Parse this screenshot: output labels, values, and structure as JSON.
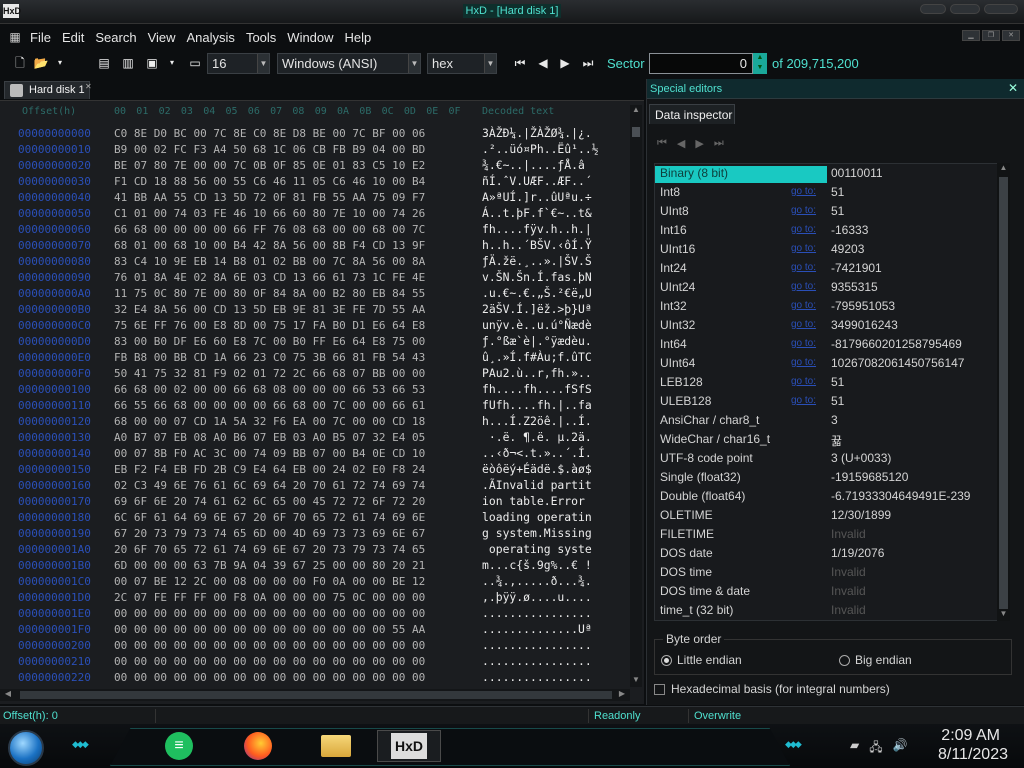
{
  "window": {
    "title": "HxD - [Hard disk 1]",
    "app_icon": "HxD"
  },
  "menu": [
    "File",
    "Edit",
    "Search",
    "View",
    "Analysis",
    "Tools",
    "Window",
    "Help"
  ],
  "toolbar": {
    "bytes_per_row": "16",
    "charset": "Windows (ANSI)",
    "offset_base": "hex",
    "sector_label": "Sector",
    "sector_value": "0",
    "sector_total": "of 209,715,200"
  },
  "document_tab": "Hard disk 1",
  "hex_header": {
    "offset_label": "Offset(h)",
    "columns": [
      "00",
      "01",
      "02",
      "03",
      "04",
      "05",
      "06",
      "07",
      "08",
      "09",
      "0A",
      "0B",
      "0C",
      "0D",
      "0E",
      "0F"
    ],
    "text_label": "Decoded text"
  },
  "hex_rows": [
    {
      "offset": "00000000000",
      "bytes": "C0 8E D0 BC 00 7C 8E C0 8E D8 BE 00 7C BF 00 06",
      "text": "3ÀŽÐ¼.|ŽÀŽØ¾.|¿."
    },
    {
      "offset": "00000000010",
      "bytes": "B9 00 02 FC F3 A4 50 68 1C 06 CB FB B9 04 00 BD",
      "text": ".²..üó¤Ph..Ëû¹..½"
    },
    {
      "offset": "00000000020",
      "bytes": "BE 07 80 7E 00 00 7C 0B 0F 85 0E 01 83 C5 10 E2",
      "text": "¾.€~..|....ƒÅ.â"
    },
    {
      "offset": "00000000030",
      "bytes": "F1 CD 18 88 56 00 55 C6 46 11 05 C6 46 10 00 B4",
      "text": "ñÍ.ˆV.UÆF..ÆF..´"
    },
    {
      "offset": "00000000040",
      "bytes": "41 BB AA 55 CD 13 5D 72 0F 81 FB 55 AA 75 09 F7",
      "text": "A»ªUÍ.]r..ûUªu.÷"
    },
    {
      "offset": "00000000050",
      "bytes": "C1 01 00 74 03 FE 46 10 66 60 80 7E 10 00 74 26",
      "text": "Á..t.þF.f`€~..t&"
    },
    {
      "offset": "00000000060",
      "bytes": "66 68 00 00 00 00 66 FF 76 08 68 00 00 68 00 7C",
      "text": "fh....fÿv.h..h.|"
    },
    {
      "offset": "00000000070",
      "bytes": "68 01 00 68 10 00 B4 42 8A 56 00 8B F4 CD 13 9F",
      "text": "h..h..´BŠV.‹ôÍ.Ÿ"
    },
    {
      "offset": "00000000080",
      "bytes": "83 C4 10 9E EB 14 B8 01 02 BB 00 7C 8A 56 00 8A",
      "text": "ƒÄ.žë.¸..».|ŠV.Š"
    },
    {
      "offset": "00000000090",
      "bytes": "76 01 8A 4E 02 8A 6E 03 CD 13 66 61 73 1C FE 4E",
      "text": "v.ŠN.Šn.Í.fas.þN"
    },
    {
      "offset": "000000000A0",
      "bytes": "11 75 0C 80 7E 00 80 0F 84 8A 00 B2 80 EB 84 55",
      "text": ".u.€~.€.„Š.²€ë„U"
    },
    {
      "offset": "000000000B0",
      "bytes": "32 E4 8A 56 00 CD 13 5D EB 9E 81 3E FE 7D 55 AA",
      "text": "2äŠV.Í.]ëž.>þ}Uª"
    },
    {
      "offset": "000000000C0",
      "bytes": "75 6E FF 76 00 E8 8D 00 75 17 FA B0 D1 E6 64 E8",
      "text": "unÿv.è..u.ú°Ñædè"
    },
    {
      "offset": "000000000D0",
      "bytes": "83 00 B0 DF E6 60 E8 7C 00 B0 FF E6 64 E8 75 00",
      "text": "ƒ.°ßæ`è|.°ÿædèu."
    },
    {
      "offset": "000000000E0",
      "bytes": "FB B8 00 BB CD 1A 66 23 C0 75 3B 66 81 FB 54 43",
      "text": "û¸.»Í.f#Àu;f.ûTC"
    },
    {
      "offset": "000000000F0",
      "bytes": "50 41 75 32 81 F9 02 01 72 2C 66 68 07 BB 00 00",
      "text": "PAu2.ù..r,fh.».."
    },
    {
      "offset": "00000000100",
      "bytes": "66 68 00 02 00 00 66 68 08 00 00 00 66 53 66 53",
      "text": "fh....fh....fSfS"
    },
    {
      "offset": "00000000110",
      "bytes": "66 55 66 68 00 00 00 00 66 68 00 7C 00 00 66 61",
      "text": "fUfh....fh.|..fa"
    },
    {
      "offset": "00000000120",
      "bytes": "68 00 00 07 CD 1A 5A 32 F6 EA 00 7C 00 00 CD 18",
      "text": "h...Í.Z2öê.|..Í."
    },
    {
      "offset": "00000000130",
      "bytes": "A0 B7 07 EB 08 A0 B6 07 EB 03 A0 B5 07 32 E4 05",
      "text": " ·.ë. ¶.ë. µ.2ä."
    },
    {
      "offset": "00000000140",
      "bytes": "00 07 8B F0 AC 3C 00 74 09 BB 07 00 B4 0E CD 10",
      "text": "..‹ð¬<.t.»..´.Í."
    },
    {
      "offset": "00000000150",
      "bytes": "EB F2 F4 EB FD 2B C9 E4 64 EB 00 24 02 E0 F8 24",
      "text": "ëòôëý+Éädë.$.àø$"
    },
    {
      "offset": "00000000160",
      "bytes": "02 C3 49 6E 76 61 6C 69 64 20 70 61 72 74 69 74",
      "text": ".ÃInvalid partit"
    },
    {
      "offset": "00000000170",
      "bytes": "69 6F 6E 20 74 61 62 6C 65 00 45 72 72 6F 72 20",
      "text": "ion table.Error "
    },
    {
      "offset": "00000000180",
      "bytes": "6C 6F 61 64 69 6E 67 20 6F 70 65 72 61 74 69 6E",
      "text": "loading operatin"
    },
    {
      "offset": "00000000190",
      "bytes": "67 20 73 79 73 74 65 6D 00 4D 69 73 73 69 6E 67",
      "text": "g system.Missing"
    },
    {
      "offset": "000000001A0",
      "bytes": "20 6F 70 65 72 61 74 69 6E 67 20 73 79 73 74 65",
      "text": " operating syste"
    },
    {
      "offset": "000000001B0",
      "bytes": "6D 00 00 00 63 7B 9A 04 39 67 25 00 00 80 20 21",
      "text": "m...c{š.9g%..€ !"
    },
    {
      "offset": "000000001C0",
      "bytes": "00 07 BE 12 2C 00 08 00 00 00 F0 0A 00 00 BE 12",
      "text": "..¾.,.....ð...¾."
    },
    {
      "offset": "000000001D0",
      "bytes": "2C 07 FE FF FF 00 F8 0A 00 00 00 75 0C 00 00 00",
      "text": ",.þÿÿ.ø....u...."
    },
    {
      "offset": "000000001E0",
      "bytes": "00 00 00 00 00 00 00 00 00 00 00 00 00 00 00 00",
      "text": "................"
    },
    {
      "offset": "000000001F0",
      "bytes": "00 00 00 00 00 00 00 00 00 00 00 00 00 00 55 AA",
      "text": "..............Uª"
    },
    {
      "offset": "00000000200",
      "bytes": "00 00 00 00 00 00 00 00 00 00 00 00 00 00 00 00",
      "text": "................"
    },
    {
      "offset": "00000000210",
      "bytes": "00 00 00 00 00 00 00 00 00 00 00 00 00 00 00 00",
      "text": "................"
    },
    {
      "offset": "00000000220",
      "bytes": "00 00 00 00 00 00 00 00 00 00 00 00 00 00 00 00",
      "text": "................"
    }
  ],
  "special_editors": {
    "title": "Special editors",
    "tab": "Data inspector",
    "link_label": "go to:",
    "rows": [
      {
        "name": "Binary (8 bit)",
        "value": "00110011",
        "selected": true,
        "link": false,
        "dim": false
      },
      {
        "name": "Int8",
        "value": "51",
        "selected": false,
        "link": true,
        "dim": false
      },
      {
        "name": "UInt8",
        "value": "51",
        "selected": false,
        "link": true,
        "dim": false
      },
      {
        "name": "Int16",
        "value": "-16333",
        "selected": false,
        "link": true,
        "dim": false
      },
      {
        "name": "UInt16",
        "value": "49203",
        "selected": false,
        "link": true,
        "dim": false
      },
      {
        "name": "Int24",
        "value": "-7421901",
        "selected": false,
        "link": true,
        "dim": false
      },
      {
        "name": "UInt24",
        "value": "9355315",
        "selected": false,
        "link": true,
        "dim": false
      },
      {
        "name": "Int32",
        "value": "-795951053",
        "selected": false,
        "link": true,
        "dim": false
      },
      {
        "name": "UInt32",
        "value": "3499016243",
        "selected": false,
        "link": true,
        "dim": false
      },
      {
        "name": "Int64",
        "value": "-8179660201258795469",
        "selected": false,
        "link": true,
        "dim": false
      },
      {
        "name": "UInt64",
        "value": "10267082061450756147",
        "selected": false,
        "link": true,
        "dim": false
      },
      {
        "name": "LEB128",
        "value": "51",
        "selected": false,
        "link": true,
        "dim": false
      },
      {
        "name": "ULEB128",
        "value": "51",
        "selected": false,
        "link": true,
        "dim": false
      },
      {
        "name": "AnsiChar / char8_t",
        "value": "3",
        "selected": false,
        "link": false,
        "dim": false
      },
      {
        "name": "WideChar / char16_t",
        "value": "뀳",
        "selected": false,
        "link": false,
        "dim": false
      },
      {
        "name": "UTF-8 code point",
        "value": "3 (U+0033)",
        "selected": false,
        "link": false,
        "dim": false
      },
      {
        "name": "Single (float32)",
        "value": "-19159685120",
        "selected": false,
        "link": false,
        "dim": false
      },
      {
        "name": "Double (float64)",
        "value": "-6.71933304649491E-239",
        "selected": false,
        "link": false,
        "dim": false
      },
      {
        "name": "OLETIME",
        "value": "12/30/1899",
        "selected": false,
        "link": false,
        "dim": false
      },
      {
        "name": "FILETIME",
        "value": "Invalid",
        "selected": false,
        "link": false,
        "dim": true
      },
      {
        "name": "DOS date",
        "value": "1/19/2076",
        "selected": false,
        "link": false,
        "dim": false
      },
      {
        "name": "DOS time",
        "value": "Invalid",
        "selected": false,
        "link": false,
        "dim": true
      },
      {
        "name": "DOS time & date",
        "value": "Invalid",
        "selected": false,
        "link": false,
        "dim": true
      },
      {
        "name": "time_t (32 bit)",
        "value": "Invalid",
        "selected": false,
        "link": false,
        "dim": true
      }
    ],
    "byte_order_label": "Byte order",
    "little_endian": "Little endian",
    "big_endian": "Big endian",
    "hex_basis": "Hexadecimal basis (for integral numbers)"
  },
  "status": {
    "offset": "Offset(h): 0",
    "readonly": "Readonly",
    "overwrite": "Overwrite"
  },
  "taskbar": {
    "time": "2:09 AM",
    "date": "8/11/2023",
    "hxd_label": "HxD"
  },
  "colors": {
    "accent": "#4fe0cf",
    "selection": "#19c9c2",
    "offset_blue": "#2a4fb8"
  }
}
